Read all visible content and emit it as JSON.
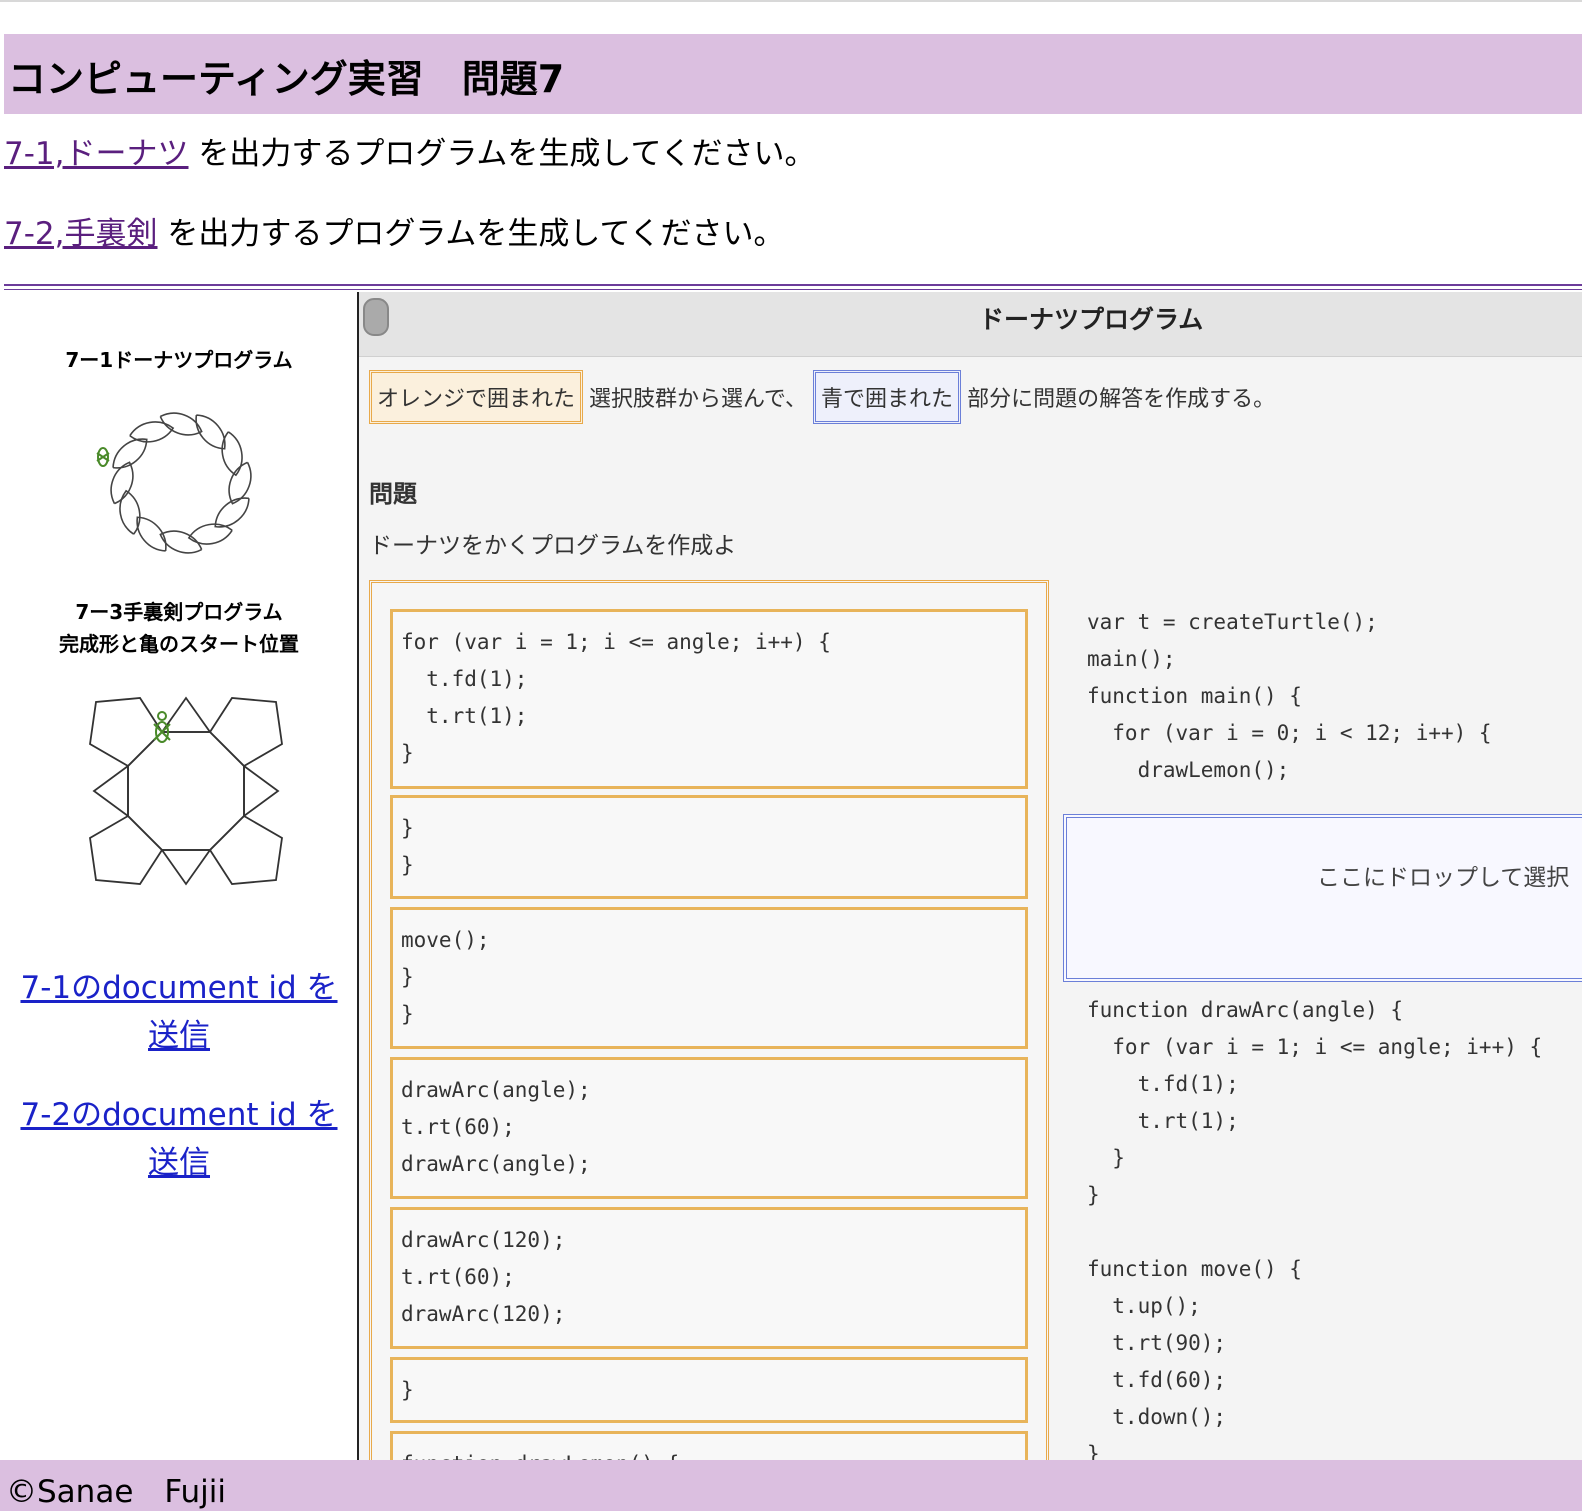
{
  "header": {
    "title": "コンピューティング実習　問題7"
  },
  "tasks": [
    {
      "link_text": "7-1,ドーナツ",
      "rest": " を出力するプログラムを生成してください。"
    },
    {
      "link_text": "7-2,手裏剣",
      "rest": " を出力するプログラムを生成してください。"
    }
  ],
  "sidebar": {
    "donut_title": "7ー1ドーナツプログラム",
    "shuriken_title_line1": "7ー3手裏剣プログラム",
    "shuriken_title_line2": "完成形と亀のスタート位置",
    "links": [
      {
        "line1": "7-1のdocument id を",
        "line2": "送信"
      },
      {
        "line1": "7-2のdocument id を",
        "line2": "送信"
      }
    ]
  },
  "embedded": {
    "title": "ドーナツプログラム",
    "instruction": {
      "orange_label": "オレンジで囲まれた",
      "middle": "選択肢群から選んで、",
      "blue_label": "青で囲まれた",
      "end": "部分に問題の解答を作成する。"
    },
    "question_heading": "問題",
    "question_text": "ドーナツをかくプログラムを作成よ",
    "choices": [
      "for (var i = 1; i <= angle; i++) {\n  t.fd(1);\n  t.rt(1);\n}",
      "}\n}",
      "move();\n}\n}",
      "drawArc(angle);\nt.rt(60);\ndrawArc(angle);",
      "drawArc(120);\nt.rt(60);\ndrawArc(120);",
      "}",
      "function drawLemon() {"
    ],
    "code_top": "var t = createTurtle();\nmain();\nfunction main() {\n  for (var i = 0; i < 12; i++) {\n    drawLemon();",
    "drop_label": "ここにドロップして選択",
    "code_bottom": "function drawArc(angle) {\n  for (var i = 1; i <= angle; i++) {\n    t.fd(1);\n    t.rt(1);\n  }\n}\n\nfunction move() {\n  t.up();\n  t.rt(90);\n  t.fd(60);\n  t.down();\n}"
  },
  "footer": {
    "copyright": "©Sanae　Fujii"
  }
}
